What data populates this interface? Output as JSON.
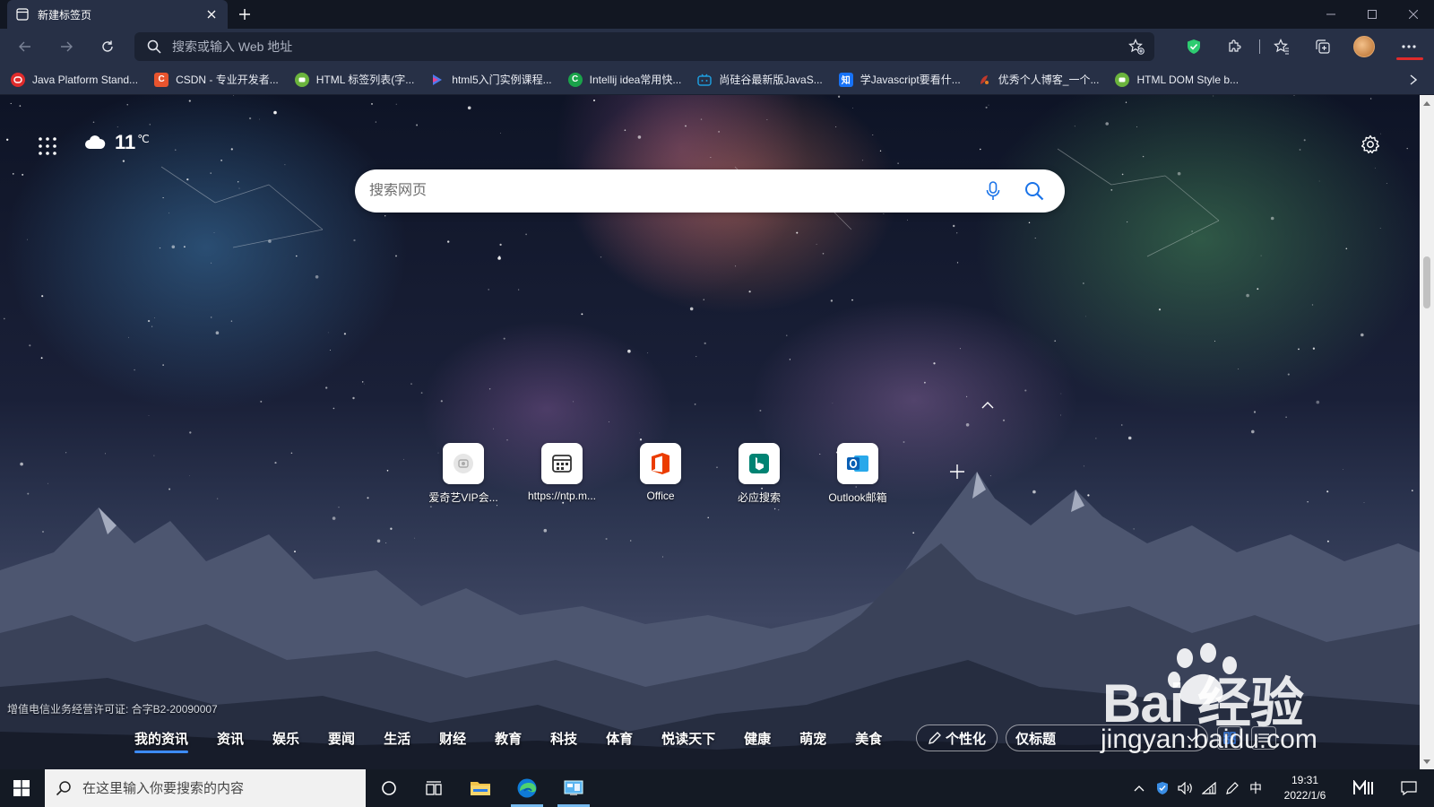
{
  "browser": {
    "tab": {
      "title": "新建标签页"
    },
    "address_bar": {
      "placeholder": "搜索或输入 Web 地址"
    },
    "favorites": [
      {
        "label": "Java Platform Stand...",
        "icon": "java-icon",
        "color": "#e02b2b"
      },
      {
        "label": "CSDN - 专业开发者...",
        "icon": "csdn-icon",
        "color": "#e8542e",
        "glyph": "C"
      },
      {
        "label": "HTML 标签列表(字...",
        "icon": "runoob-icon",
        "color": "#6bb43d"
      },
      {
        "label": "html5入门实例课程...",
        "icon": "html5-icon",
        "color": "#4b7bec"
      },
      {
        "label": "Intellij idea常用快...",
        "icon": "intellij-icon",
        "color": "#1aa34a",
        "glyph": "C"
      },
      {
        "label": "尚硅谷最新版JavaS...",
        "icon": "bilibili-icon",
        "color": "#1f9cdc"
      },
      {
        "label": "学Javascript要看什...",
        "icon": "zhihu-icon",
        "color": "#1772f6",
        "glyph": "知"
      },
      {
        "label": "优秀个人博客_一个...",
        "icon": "blog-icon",
        "color": "#c0392b"
      },
      {
        "label": "HTML DOM Style b...",
        "icon": "runoob-icon",
        "color": "#6bb43d"
      }
    ]
  },
  "newtab": {
    "weather": {
      "temp": "11",
      "unit": "℃",
      "icon": "cloud-icon"
    },
    "search": {
      "placeholder": "搜索网页"
    },
    "quick_links": [
      {
        "label": "爱奇艺VIP会...",
        "icon": "iqiyi-icon"
      },
      {
        "label": "https://ntp.m...",
        "icon": "calendar-page-icon"
      },
      {
        "label": "Office",
        "icon": "office-icon"
      },
      {
        "label": "必应搜索",
        "icon": "bing-icon"
      },
      {
        "label": "Outlook邮箱",
        "icon": "outlook-icon"
      }
    ],
    "license": "增值电信业务经营许可证: 合字B2-20090007",
    "news_tabs": [
      "我的资讯",
      "资讯",
      "娱乐",
      "要闻",
      "生活",
      "财经",
      "教育",
      "科技",
      "体育",
      "悦读天下",
      "健康",
      "萌宠",
      "美食"
    ],
    "news_active": 0,
    "personalize_label": "个性化",
    "headline_option": "仅标题"
  },
  "watermark": {
    "brand": "Bai 经验",
    "url": "jingyan.baidu.com"
  },
  "taskbar": {
    "search_placeholder": "在这里输入你要搜索的内容",
    "time": "19:31",
    "date": "2022/1/6",
    "ime": "中"
  },
  "colors": {
    "accent": "#3d8cff",
    "tab_bg": "#273046",
    "taskbar": "#141a24"
  }
}
